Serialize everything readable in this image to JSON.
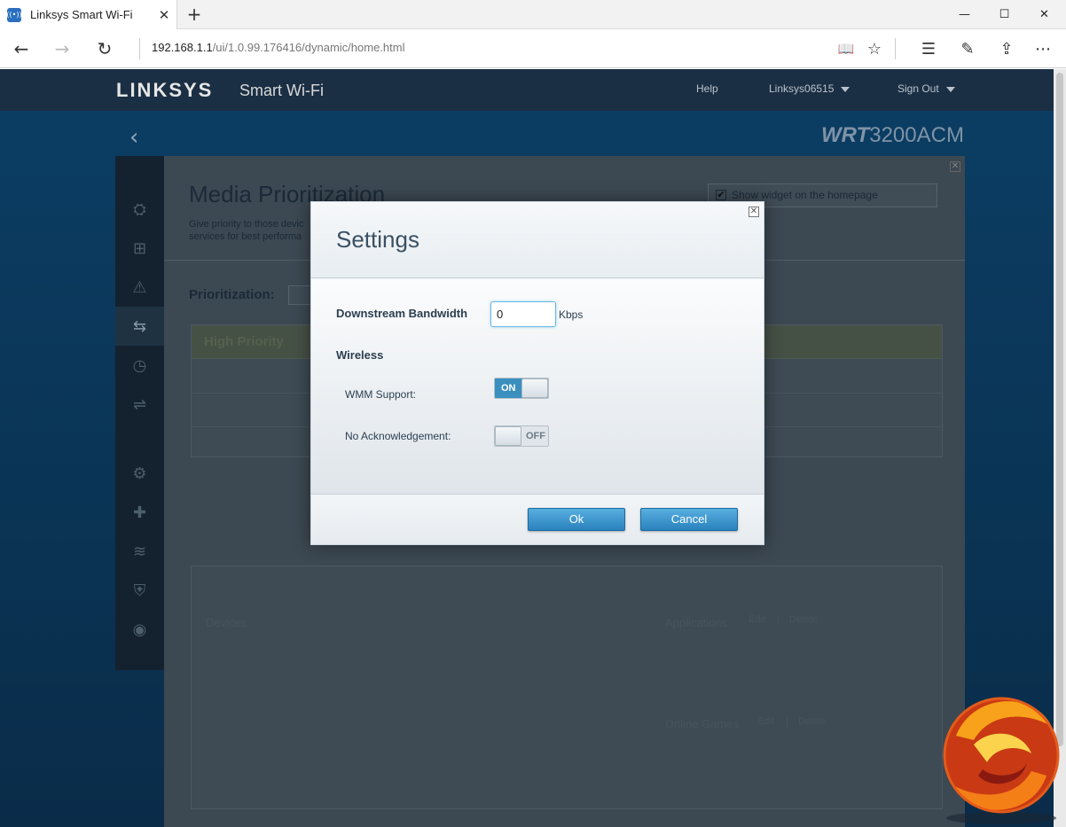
{
  "browser": {
    "tab_title": "Linksys Smart Wi-Fi",
    "tab_favicon": "((•))",
    "address_host": "192.168.1.1",
    "address_path": "/ui/1.0.99.176416/dynamic/home.html",
    "icons": {
      "close_tab": "✕",
      "new_tab": "+",
      "minimize": "—",
      "maximize": "☐",
      "close_window": "✕",
      "back": "←",
      "forward": "→",
      "refresh": "↻",
      "reading_view": "📖",
      "favorite": "☆",
      "hub": "☰",
      "web_note": "✎",
      "share": "⇪",
      "more": "⋯"
    }
  },
  "header": {
    "logo": "LINKSYS",
    "logo_sub": "Smart Wi-Fi",
    "help": "Help",
    "account": "Linksys06515",
    "sign_out": "Sign Out",
    "model_prefix": "WRT",
    "model_suffix": "3200ACM"
  },
  "sidebar": {
    "icons": [
      "⛭",
      "⊞",
      "⚠",
      "⇆",
      "◷",
      "⇌",
      "⚙",
      "✚",
      "≋",
      "⛨",
      "◉"
    ],
    "back": "‹"
  },
  "background_page": {
    "title": "Media Prioritization",
    "description": "Give priority to those devic services for best performa",
    "show_widget": "Show widget on the homepage",
    "prioritization_label": "Prioritization:",
    "high_priority": "High Priority",
    "devices": "Devices",
    "applications": "Applications",
    "online_games": "Online Games",
    "edit": "Edit",
    "delete": "Delete",
    "separator": "|",
    "check": "✔",
    "close": "✕"
  },
  "modal": {
    "title": "Settings",
    "close": "✕",
    "downstream_label": "Downstream Bandwidth",
    "downstream_value": "0",
    "downstream_unit": "Kbps",
    "wireless_title": "Wireless",
    "wmm_label": "WMM Support:",
    "wmm_state": "ON",
    "noack_label": "No Acknowledgement:",
    "noack_state": "OFF",
    "ok": "Ok",
    "cancel": "Cancel"
  },
  "colors": {
    "accent": "#3b8fbf",
    "page_bg": "#0b3d63",
    "modal_title": "#3a5063"
  }
}
